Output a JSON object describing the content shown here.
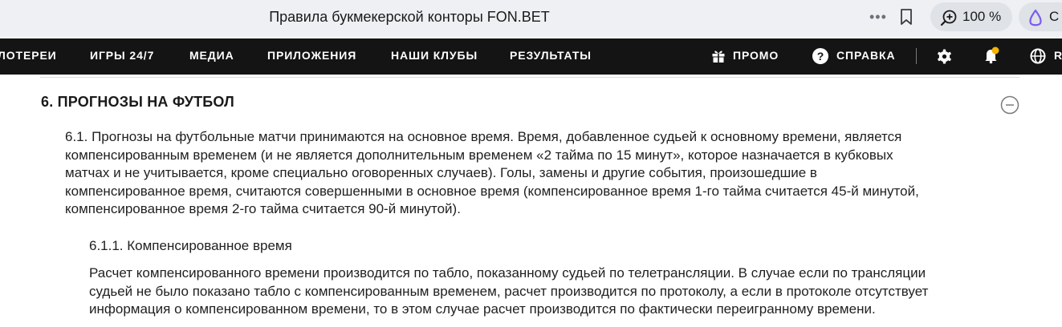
{
  "browser": {
    "title": "Правила букмекерской конторы FON.BET",
    "zoom": "100 %",
    "alice_label": "С"
  },
  "nav": {
    "items": [
      "ЛОТЕРЕИ",
      "ИГРЫ 24/7",
      "МЕДИА",
      "ПРИЛОЖЕНИЯ",
      "НАШИ КЛУБЫ",
      "РЕЗУЛЬТАТЫ"
    ],
    "promo": "ПРОМО",
    "help": "СПРАВКА",
    "lang": "R",
    "colors": {
      "bg": "#141414",
      "notification_dot": "#f5b400"
    }
  },
  "section": {
    "title": "6. ПРОГНОЗЫ НА ФУТБОЛ",
    "paragraph_lines": [
      "6.1. Прогнозы на футбольные матчи принимаются на основное время. Время, добавленное судьей к основному времени, является",
      "компенсированным временем (и не является дополнительным временем «2 тайма по 15 минут», которое назначается в кубковых",
      "матчах и не учитывается, кроме специально оговоренных случаев). Голы, замены и другие события, произошедшие в",
      "компенсированное время, считаются совершенными в основное время (компенсированное время 1-го тайма считается 45-й минутой,",
      "компенсированное время 2-го тайма считается 90-й минутой)."
    ],
    "subsection": {
      "title": "6.1.1. Компенсированное время",
      "paragraph_lines": [
        "Расчет компенсированного времени производится по табло, показанному судьей по телетрансляции. В случае если по трансляции",
        "судьей не было показано табло с компенсированным временем, расчет производится по протоколу, а если в протоколе отсутствует",
        "информация о компенсированном времени, то в этом случае расчет производится по фактически переигранному времени."
      ]
    }
  }
}
